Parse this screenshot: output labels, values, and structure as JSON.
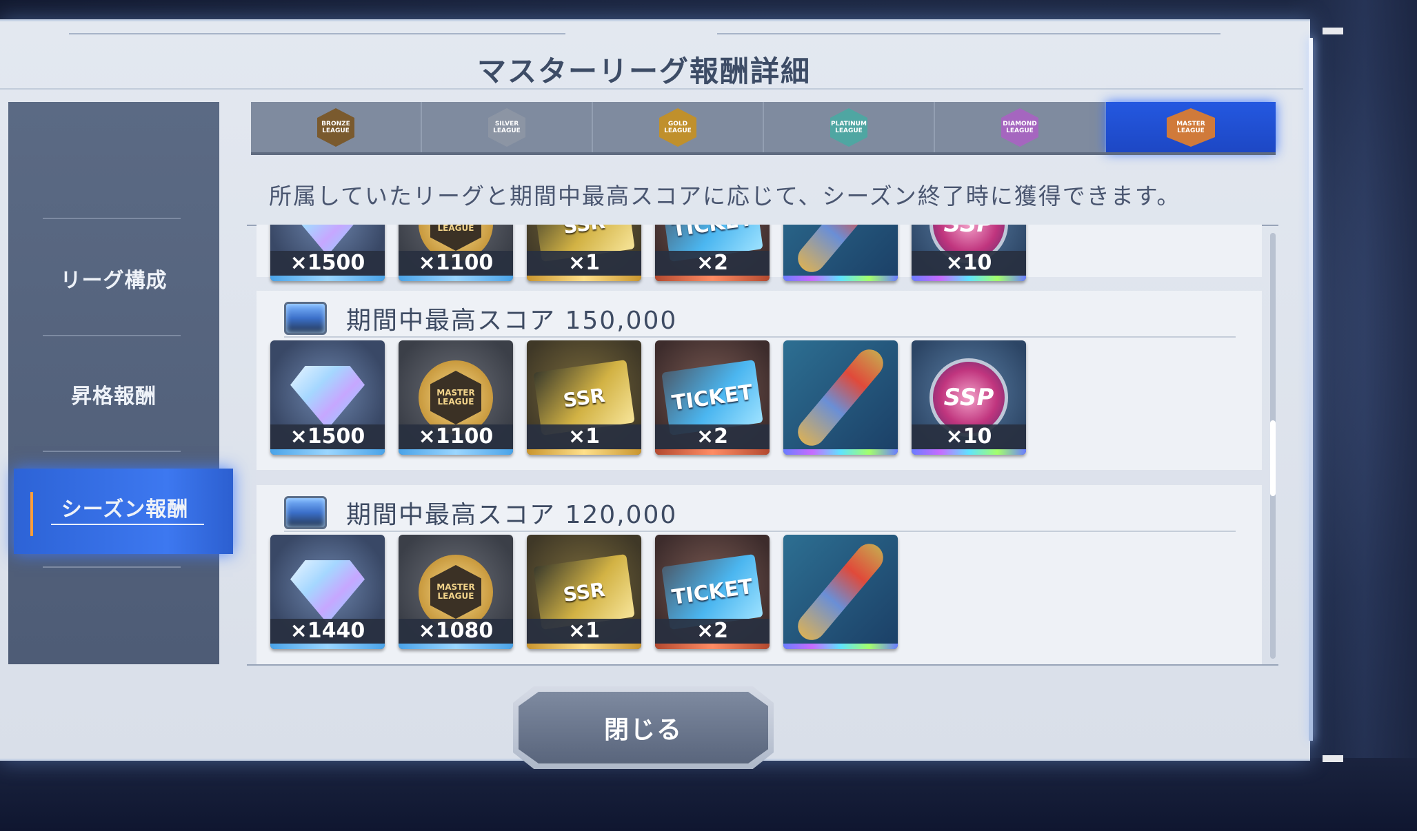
{
  "header": {
    "title": "マスターリーグ報酬詳細"
  },
  "sidebar": {
    "items": [
      {
        "label": "リーグ構成"
      },
      {
        "label": "昇格報酬"
      },
      {
        "label": "シーズン報酬"
      }
    ],
    "active_index": 2
  },
  "league_tabs": [
    {
      "name": "BRONZE LEAGUE",
      "icon": "bronze-league-badge",
      "color": "#8a6a3a"
    },
    {
      "name": "SILVER LEAGUE",
      "icon": "silver-league-badge",
      "color": "#9aa3b0"
    },
    {
      "name": "GOLD LEAGUE",
      "icon": "gold-league-badge",
      "color": "#c99a32"
    },
    {
      "name": "PLATINUM LEAGUE",
      "icon": "platinum-league-badge",
      "color": "#5fb9b4"
    },
    {
      "name": "DIAMOND LEAGUE",
      "icon": "diamond-league-badge",
      "color": "#b47acb"
    },
    {
      "name": "MASTER LEAGUE",
      "icon": "master-league-badge",
      "color": "#d8793a"
    }
  ],
  "active_tab_index": 5,
  "description": "所属していたリーグと期間中最高スコアに応じて、シーズン終了時に獲得できます。",
  "reward_groups": [
    {
      "title": "",
      "items": [
        {
          "type": "diamond",
          "qty": "×1500"
        },
        {
          "type": "master-coin",
          "qty": "×1100"
        },
        {
          "type": "ssr-ticket",
          "qty": "×1"
        },
        {
          "type": "ticket",
          "qty": "×2"
        },
        {
          "type": "scroll",
          "qty": ""
        },
        {
          "type": "ssp",
          "qty": "×10"
        }
      ]
    },
    {
      "title": "期間中最高スコア 150,000",
      "items": [
        {
          "type": "diamond",
          "qty": "×1500"
        },
        {
          "type": "master-coin",
          "qty": "×1100"
        },
        {
          "type": "ssr-ticket",
          "qty": "×1"
        },
        {
          "type": "ticket",
          "qty": "×2"
        },
        {
          "type": "scroll",
          "qty": ""
        },
        {
          "type": "ssp",
          "qty": "×10"
        }
      ]
    },
    {
      "title": "期間中最高スコア 120,000",
      "items": [
        {
          "type": "diamond",
          "qty": "×1440"
        },
        {
          "type": "master-coin",
          "qty": "×1080"
        },
        {
          "type": "ssr-ticket",
          "qty": "×1"
        },
        {
          "type": "ticket",
          "qty": "×2"
        },
        {
          "type": "scroll",
          "qty": ""
        }
      ]
    }
  ],
  "item_art": {
    "coin_label": "MASTER LEAGUE",
    "ssr_label": "SSR",
    "ticket_label": "TICKET",
    "ssp_label": "SSP"
  },
  "footer": {
    "close_label": "閉じる"
  },
  "colors": {
    "accent_blue": "#2d63d6",
    "panel_bg": "#e3e8f0",
    "sidebar_bg": "#56647e"
  }
}
